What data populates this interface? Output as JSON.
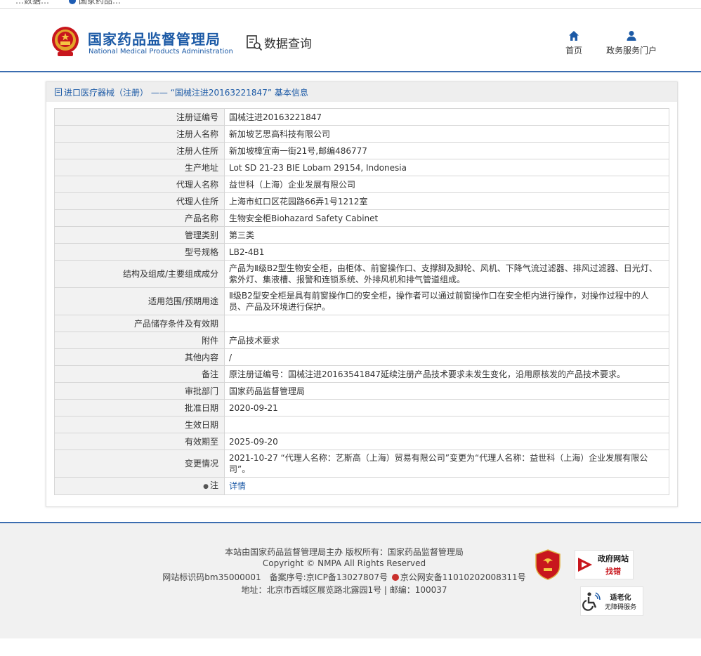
{
  "topstrip": {
    "tab1": "…数据…",
    "tab2": "国家药品…"
  },
  "header": {
    "title_cn": "国家药品监督管理局",
    "title_en": "National Medical Products Administration",
    "query_label": "数据查询",
    "nav_home": "首页",
    "nav_portal": "政务服务门户"
  },
  "panel": {
    "title": "进口医疗器械（注册） —— “国械注进20163221847” 基本信息"
  },
  "rows": [
    {
      "key": "注册证编号",
      "value": "国械注进20163221847"
    },
    {
      "key": "注册人名称",
      "value": "新加坡艺思高科技有限公司"
    },
    {
      "key": "注册人住所",
      "value": "新加坡樟宜南一街21号,邮编486777"
    },
    {
      "key": "生产地址",
      "value": "Lot SD 21-23 BIE Lobam 29154, Indonesia"
    },
    {
      "key": "代理人名称",
      "value": "益世科（上海）企业发展有限公司"
    },
    {
      "key": "代理人住所",
      "value": "上海市虹口区花园路66弄1号1212室"
    },
    {
      "key": "产品名称",
      "value": "生物安全柜Biohazard Safety Cabinet"
    },
    {
      "key": "管理类别",
      "value": "第三类"
    },
    {
      "key": "型号规格",
      "value": "LB2-4B1"
    },
    {
      "key": "结构及组成/主要组成成分",
      "value": "产品为Ⅱ级B2型生物安全柜，由柜体、前窗操作口、支撑脚及脚轮、风机、下降气流过滤器、排风过滤器、日光灯、紫外灯、集液槽、报警和连锁系统、外排风机和排气管道组成。"
    },
    {
      "key": "适用范围/预期用途",
      "value": "Ⅱ级B2型安全柜是具有前窗操作口的安全柜，操作者可以通过前窗操作口在安全柜内进行操作，对操作过程中的人员、产品及环境进行保护。"
    },
    {
      "key": "产品储存条件及有效期",
      "value": ""
    },
    {
      "key": "附件",
      "value": "产品技术要求"
    },
    {
      "key": "其他内容",
      "value": "/"
    },
    {
      "key": "备注",
      "value": "原注册证编号：国械注进20163541847延续注册产品技术要求未发生变化，沿用原核发的产品技术要求。"
    },
    {
      "key": "审批部门",
      "value": "国家药品监督管理局"
    },
    {
      "key": "批准日期",
      "value": "2020-09-21"
    },
    {
      "key": "生效日期",
      "value": ""
    },
    {
      "key": "有效期至",
      "value": "2025-09-20"
    },
    {
      "key": "变更情况",
      "value": "2021-10-27 “代理人名称：艺斯高（上海）贸易有限公司”变更为“代理人名称：益世科（上海）企业发展有限公司”。"
    }
  ],
  "note_row": {
    "key": "注",
    "link": "详情"
  },
  "footer": {
    "line1": "本站由国家药品监督管理局主办 版权所有：国家药品监督管理局",
    "line2": "Copyright © NMPA All Rights Reserved",
    "line3a": "网站标识码bm35000001　备案序号:京ICP备13027807号",
    "line3b": "京公网安备11010202008311号",
    "line4": "地址：北京市西城区展览路北露园1号 | 邮编：100037",
    "gov_badge_l1": "政府网站",
    "gov_badge_l2": "找错",
    "access_badge_l1": "适老化",
    "access_badge_l2": "无障碍服务"
  },
  "colors": {
    "brand_blue": "#1c5aa6",
    "rule_blue": "#3b6db0",
    "key_bg": "#f2f2f2"
  }
}
